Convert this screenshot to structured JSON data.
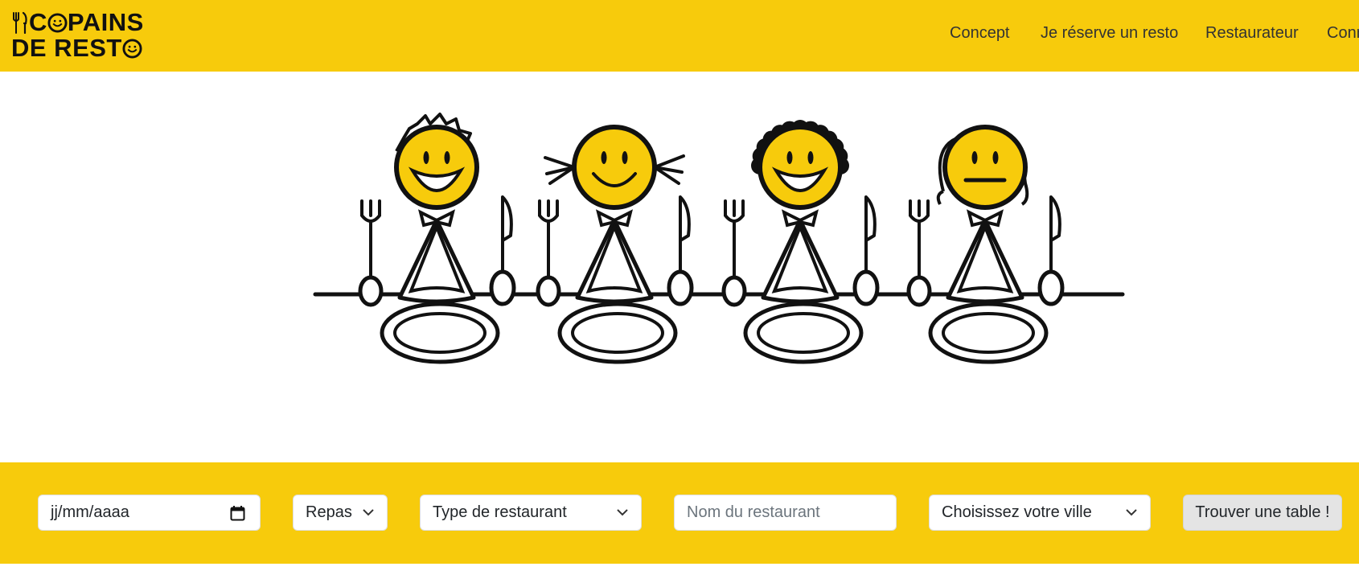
{
  "brand": {
    "line1": "COPAINS",
    "line2": "DE REST",
    "yellow": "#f7cb0c",
    "ink": "#111111"
  },
  "nav": {
    "items": [
      "Concept",
      "Je réserve un resto",
      "Restaurateur",
      "Connexion"
    ]
  },
  "hero": {
    "icon": "four-smiley-friends-at-table-illustration"
  },
  "search": {
    "date_placeholder": "jj/mm/aaaa",
    "meal_label": "Repas",
    "type_label": "Type de restaurant",
    "name_placeholder": "Nom du restaurant",
    "city_label": "Choisissez votre ville",
    "submit_label": "Trouver une table !"
  }
}
